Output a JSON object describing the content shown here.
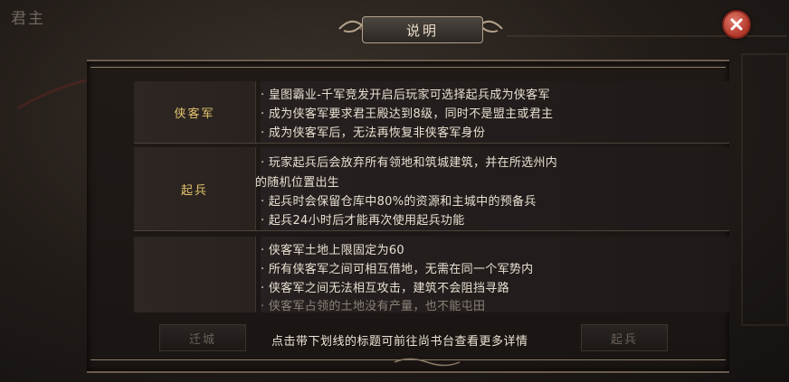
{
  "background_title": "君主",
  "dialog": {
    "title": "说明",
    "sections": [
      {
        "label": "侠客军",
        "lines": [
          "· 皇图霸业-千军竞发开启后玩家可选择起兵成为侠客军",
          "· 成为侠客军要求君王殿达到8级，同时不是盟主或君主",
          "· 成为侠客军后，无法再恢复非侠客军身份"
        ]
      },
      {
        "label": "起兵",
        "lines": [
          "· 玩家起兵后会放弃所有领地和筑城建筑，并在所选州内",
          "的随机位置出生",
          "· 起兵时会保留仓库中80%的资源和主城中的预备兵",
          "· 起兵24小时后才能再次使用起兵功能"
        ]
      },
      {
        "label": "",
        "lines": [
          "· 侠客军土地上限固定为60",
          "· 所有侠客军之间可相互借地，无需在同一个军势内",
          "· 侠客军之间无法相互攻击，建筑不会阻挡寻路",
          "· 侠客军占领的土地没有产量，也不能屯田"
        ]
      }
    ],
    "footer": {
      "left_button": "迁城",
      "note": "点击带下划线的标题可前往尚书台查看更多详情",
      "right_button": "起兵"
    }
  },
  "icons": {
    "close": "close-x-icon"
  },
  "colors": {
    "label_gold": "#e3c46f",
    "close_red": "#b13628"
  }
}
